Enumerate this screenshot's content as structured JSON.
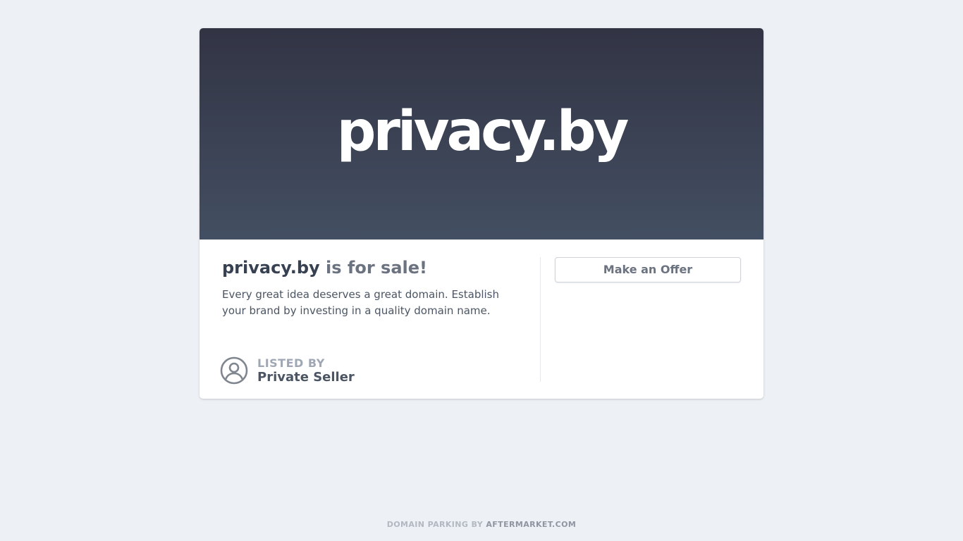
{
  "hero": {
    "domain": "privacy.by"
  },
  "listing": {
    "domain": "privacy.by",
    "headline_suffix": " is for sale!",
    "description": "Every great idea deserves a great domain. Establish your brand by investing in a quality domain name."
  },
  "seller": {
    "listed_by_label": "LISTED BY",
    "name": "Private Seller",
    "avatar_icon": "user-circle-icon"
  },
  "actions": {
    "make_offer_label": "Make an Offer"
  },
  "footer": {
    "prefix": "DOMAIN PARKING BY ",
    "brand": "AFTERMARKET.COM"
  },
  "colors": {
    "background": "#edf0f5",
    "hero_top": "#323444",
    "hero_bottom": "#434f62",
    "text_dark": "#374151",
    "text_muted": "#6b7280"
  }
}
